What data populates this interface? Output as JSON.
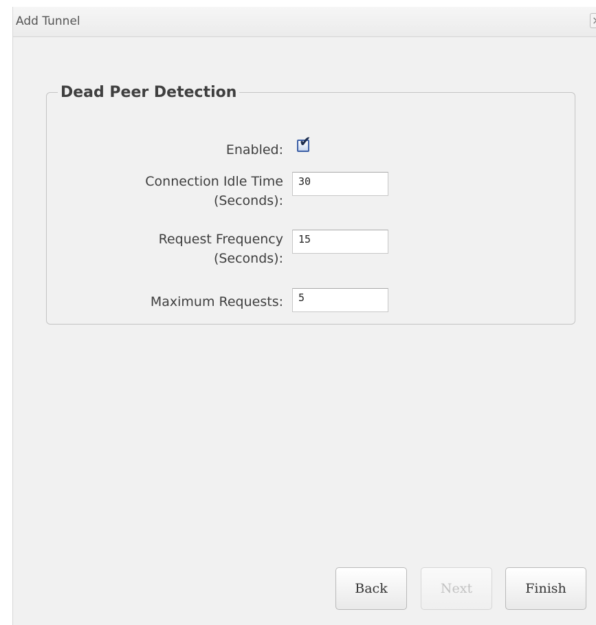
{
  "dialog": {
    "title": "Add Tunnel",
    "close_symbol": "×"
  },
  "section": {
    "legend": "Dead Peer Detection",
    "enabled": {
      "label": "Enabled:",
      "checked": true,
      "check_glyph": "✔"
    },
    "idle_time": {
      "label_line1": "Connection Idle Time",
      "label_line2": "(Seconds):",
      "value": "30"
    },
    "request_frequency": {
      "label_line1": "Request Frequency",
      "label_line2": "(Seconds):",
      "value": "15"
    },
    "max_requests": {
      "label": "Maximum Requests:",
      "value": "5"
    }
  },
  "buttons": {
    "back": "Back",
    "next": "Next",
    "finish": "Finish"
  },
  "icons": {
    "close": "close-icon",
    "checkbox": "check-icon"
  },
  "colors": {
    "dialog_background": "#f1f1f1",
    "checkbox_border": "#3b5ea5",
    "disabled_text": "#c2c2c2"
  }
}
